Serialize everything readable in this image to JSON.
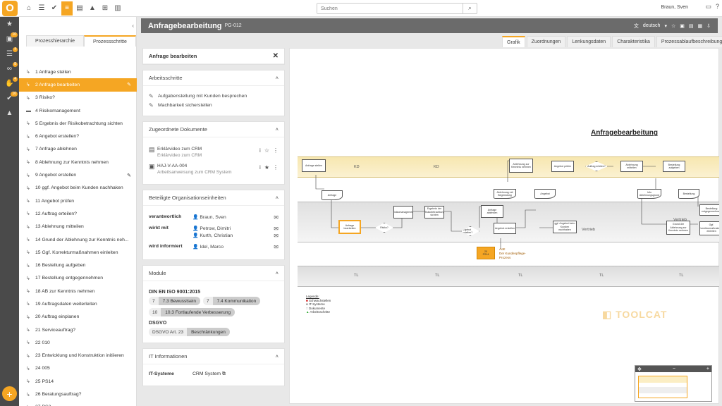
{
  "app": {
    "logo_letter": "O",
    "search_placeholder": "Suchen",
    "user": "Braun, Sven"
  },
  "rail": {
    "badges": [
      "10",
      "4",
      "8",
      "4",
      "10"
    ]
  },
  "tree": {
    "tabs": [
      "Prozesshierarchie",
      "Prozessschritte"
    ],
    "items": [
      "1 Anfrage stellen",
      "2 Anfrage bearbeiten",
      "3 Risiko?",
      "4 Risikomanagement",
      "5 Ergebnis der Risikobetrachtung sichten",
      "6 Angebot erstellen?",
      "7 Anfrage ablehnen",
      "8 Ablehnung zur Kenntnis nehmen",
      "9 Angebot erstellen",
      "10 ggf. Angebot beim Kunden nachhaken",
      "11 Angebot prüfen",
      "12 Auftrag erteilen?",
      "13 Ablehnung mitteilen",
      "14 Grund der Ablehnung zur Kenntnis neh...",
      "15 Ggf. Korrekturmaßnahmen einleiten",
      "16 Bestellung aufgeben",
      "17 Bestellung entgegennehmen",
      "18 AB zur Kenntnis nehmen",
      "19 Auftragsdaten weiterleiten",
      "20 Auftrag einplanen",
      "21 Serviceauftrag?",
      "22 010",
      "23 Entwicklung und Konstruktion initiieren",
      "24 005",
      "25 PS14",
      "26 Beratungsauftrag?",
      "27 PS2"
    ]
  },
  "header": {
    "title": "Anfragebearbeitung",
    "code": "PG-012",
    "language": "deutsch"
  },
  "right_tabs": [
    "Grafik",
    "Zuordnungen",
    "Lenkungsdaten",
    "Charakteristika",
    "Prozessablaufbeschreibung"
  ],
  "detail": {
    "title": "Anfrage bearbeiten",
    "steps": {
      "heading": "Arbeitsschritte",
      "items": [
        "Aufgabenstellung mit Kunden besprechen",
        "Machbarkeit sicherstellen"
      ]
    },
    "docs": {
      "heading": "Zugeordnete Dokumente",
      "items": [
        {
          "title": "Erklärvideo zum CRM",
          "sub": "Erklärvideo zum CRM"
        },
        {
          "title": "HAJ-V-AA-004",
          "sub": "Arbeitsanweisung zum CRM System"
        }
      ]
    },
    "org": {
      "heading": "Beteiligte Organisationseinheiten",
      "rows": [
        {
          "label": "verantwortlich",
          "names": [
            "Braun, Sven"
          ]
        },
        {
          "label": "wirkt mit",
          "names": [
            "Petrow, Dimitri",
            "Kurth, Christian"
          ]
        },
        {
          "label": "wird informiert",
          "names": [
            "Idel, Marco"
          ]
        }
      ]
    },
    "module": {
      "heading": "Module",
      "groups": [
        {
          "name": "DIN EN ISO 9001:2015",
          "chips": [
            {
              "n": "7",
              "t": "7.3 Bewusstsein"
            },
            {
              "n": "7",
              "t": "7.4 Kommunikation"
            },
            {
              "n": "10",
              "t": "10.3 Fortlaufende Verbesserung"
            }
          ]
        },
        {
          "name": "DSGVO",
          "chips": [
            {
              "n": "DSGVO Art. 23",
              "t": "Beschränkungen"
            }
          ]
        }
      ]
    },
    "it": {
      "heading": "IT Informationen",
      "label": "IT-Systeme",
      "value": "CRM System"
    }
  },
  "diagram": {
    "title": "Anfragebearbeitung",
    "lanes": {
      "kd": "KD",
      "vertrieb": "Vertrieb",
      "tl": "TL"
    },
    "boxes": {
      "b1": "Anfrage stellen",
      "b2": "Anfrage",
      "b3": "Anfrage bearbeiten",
      "b4": "Risiko?",
      "b5": "Risikomanagement",
      "b6": "Ergebnis der Risikobetrachtung sichten",
      "b7": "Angebot erstellen?",
      "b8": "Anfrage ablehnen",
      "b9": "Ablehnung mit Begründung",
      "b10": "Ablehnung zur Kenntnis nehmen",
      "b11": "Angebot prüfen",
      "b12": "Auftrag erteilen?",
      "b13": "Angebot erstellen",
      "b14": "Angebot",
      "b15": "ggf. Angebot beim Kunden nachhaken",
      "b16": "Ablehnung mitteilen",
      "b17": "Info Ablehnungsgrund",
      "b18": "Grund der Ablehnung zur Kenntnis nehmen",
      "b19": "Bestellung aufgeben",
      "b20": "Bestellung",
      "b21": "Bestellung entgegennehmen",
      "b22": "Ggf. Korrekturmaßnahmen einleiten",
      "b23": "Vertrieb"
    },
    "ps": {
      "code": "PS14",
      "num": "20"
    },
    "ps_text": [
      "AoE",
      "Der Kundenpflege-",
      "Prozess"
    ],
    "legend_title": "Legende:",
    "legend": [
      "Schwachstellen",
      "IT-Systeme",
      "Dokumente",
      "Arbeitsschritte"
    ],
    "watermark": "TOOLCAT"
  },
  "colors": {
    "accent": "#f5a623",
    "header": "#6b6b6b",
    "rail": "#4a4a4a"
  }
}
